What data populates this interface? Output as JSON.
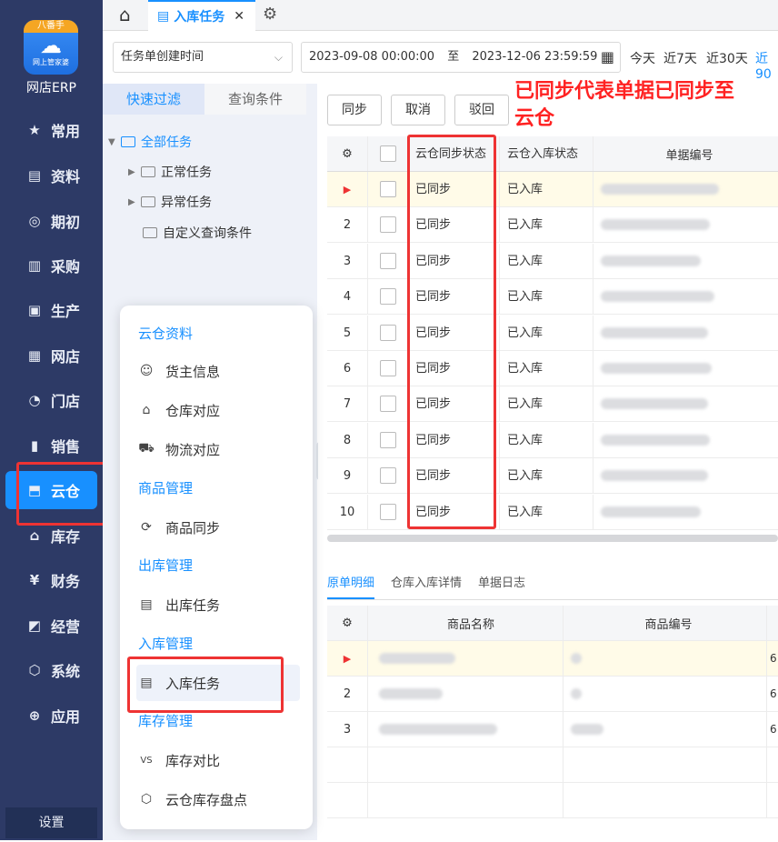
{
  "app": {
    "logo_top": "八番手",
    "logo_sub": "网上管家婆",
    "caption": "网店ERP"
  },
  "nav": [
    {
      "label": "常用",
      "icon": "star-icon",
      "glyph": "★"
    },
    {
      "label": "资料",
      "icon": "profile-icon",
      "glyph": "▤"
    },
    {
      "label": "期初",
      "icon": "target-icon",
      "glyph": "◎"
    },
    {
      "label": "采购",
      "icon": "book-icon",
      "glyph": "▥"
    },
    {
      "label": "生产",
      "icon": "factory-icon",
      "glyph": "▣"
    },
    {
      "label": "网店",
      "icon": "store-icon",
      "glyph": "▦"
    },
    {
      "label": "门店",
      "icon": "pie-icon",
      "glyph": "◔"
    },
    {
      "label": "销售",
      "icon": "chart-icon",
      "glyph": "▮"
    },
    {
      "label": "云仓",
      "icon": "cloud-warehouse-icon",
      "glyph": "⬒"
    },
    {
      "label": "库存",
      "icon": "house-icon",
      "glyph": "⌂"
    },
    {
      "label": "财务",
      "icon": "finance-icon",
      "glyph": "¥"
    },
    {
      "label": "经营",
      "icon": "trend-icon",
      "glyph": "◩"
    },
    {
      "label": "系统",
      "icon": "system-icon",
      "glyph": "⬡"
    },
    {
      "label": "应用",
      "icon": "app-plus-icon",
      "glyph": "⊕"
    }
  ],
  "settings_label": "设置",
  "tabbar": {
    "tab_label": "入库任务",
    "close": "✕"
  },
  "filter": {
    "select_value": "任务单创建时间",
    "date_start": "2023-09-08 00:00:00",
    "date_to": "至",
    "date_end": "2023-12-06 23:59:59",
    "quick": [
      "今天",
      "近7天",
      "近30天",
      "近90"
    ]
  },
  "left_panel": {
    "tab1": "快速过滤",
    "tab2": "查询条件",
    "tree": [
      "全部任务",
      "正常任务",
      "异常任务",
      "自定义查询条件"
    ]
  },
  "popup": {
    "sections": [
      "云仓资料",
      "商品管理",
      "出库管理",
      "入库管理",
      "库存管理"
    ],
    "items": [
      {
        "label": "货主信息",
        "icon": "owner-icon",
        "glyph": "☺"
      },
      {
        "label": "仓库对应",
        "icon": "warehouse-map-icon",
        "glyph": "⌂"
      },
      {
        "label": "物流对应",
        "icon": "truck-icon",
        "glyph": "⛟"
      },
      {
        "label": "商品同步",
        "icon": "sync-icon",
        "glyph": "⟳"
      },
      {
        "label": "出库任务",
        "icon": "outbound-task-icon",
        "glyph": "▤"
      },
      {
        "label": "入库任务",
        "icon": "inbound-task-icon",
        "glyph": "▤"
      },
      {
        "label": "库存对比",
        "icon": "vs-icon",
        "glyph": "VS"
      },
      {
        "label": "云仓库存盘点",
        "icon": "inventory-icon",
        "glyph": "⬡"
      }
    ]
  },
  "actions": {
    "sync": "同步",
    "cancel": "取消",
    "reject": "驳回"
  },
  "annotation": "已同步代表单据已同步至云仓",
  "grid": {
    "headers": {
      "sync": "云仓同步状态",
      "in": "云仓入库状态",
      "code": "单据编号"
    },
    "rows": [
      {
        "num": "",
        "sync": "已同步",
        "in": "已入库"
      },
      {
        "num": "2",
        "sync": "已同步",
        "in": "已入库"
      },
      {
        "num": "3",
        "sync": "已同步",
        "in": "已入库"
      },
      {
        "num": "4",
        "sync": "已同步",
        "in": "已入库"
      },
      {
        "num": "5",
        "sync": "已同步",
        "in": "已入库"
      },
      {
        "num": "6",
        "sync": "已同步",
        "in": "已入库"
      },
      {
        "num": "7",
        "sync": "已同步",
        "in": "已入库"
      },
      {
        "num": "8",
        "sync": "已同步",
        "in": "已入库"
      },
      {
        "num": "9",
        "sync": "已同步",
        "in": "已入库"
      },
      {
        "num": "10",
        "sync": "已同步",
        "in": "已入库"
      }
    ]
  },
  "detail_tabs": [
    "原单明细",
    "仓库入库详情",
    "单据日志"
  ],
  "detail_grid": {
    "headers": {
      "name": "商品名称",
      "code": "商品编号"
    },
    "rows": [
      {
        "num": "",
        "extra": "6"
      },
      {
        "num": "2",
        "extra": "6"
      },
      {
        "num": "3",
        "extra": "6"
      }
    ]
  }
}
